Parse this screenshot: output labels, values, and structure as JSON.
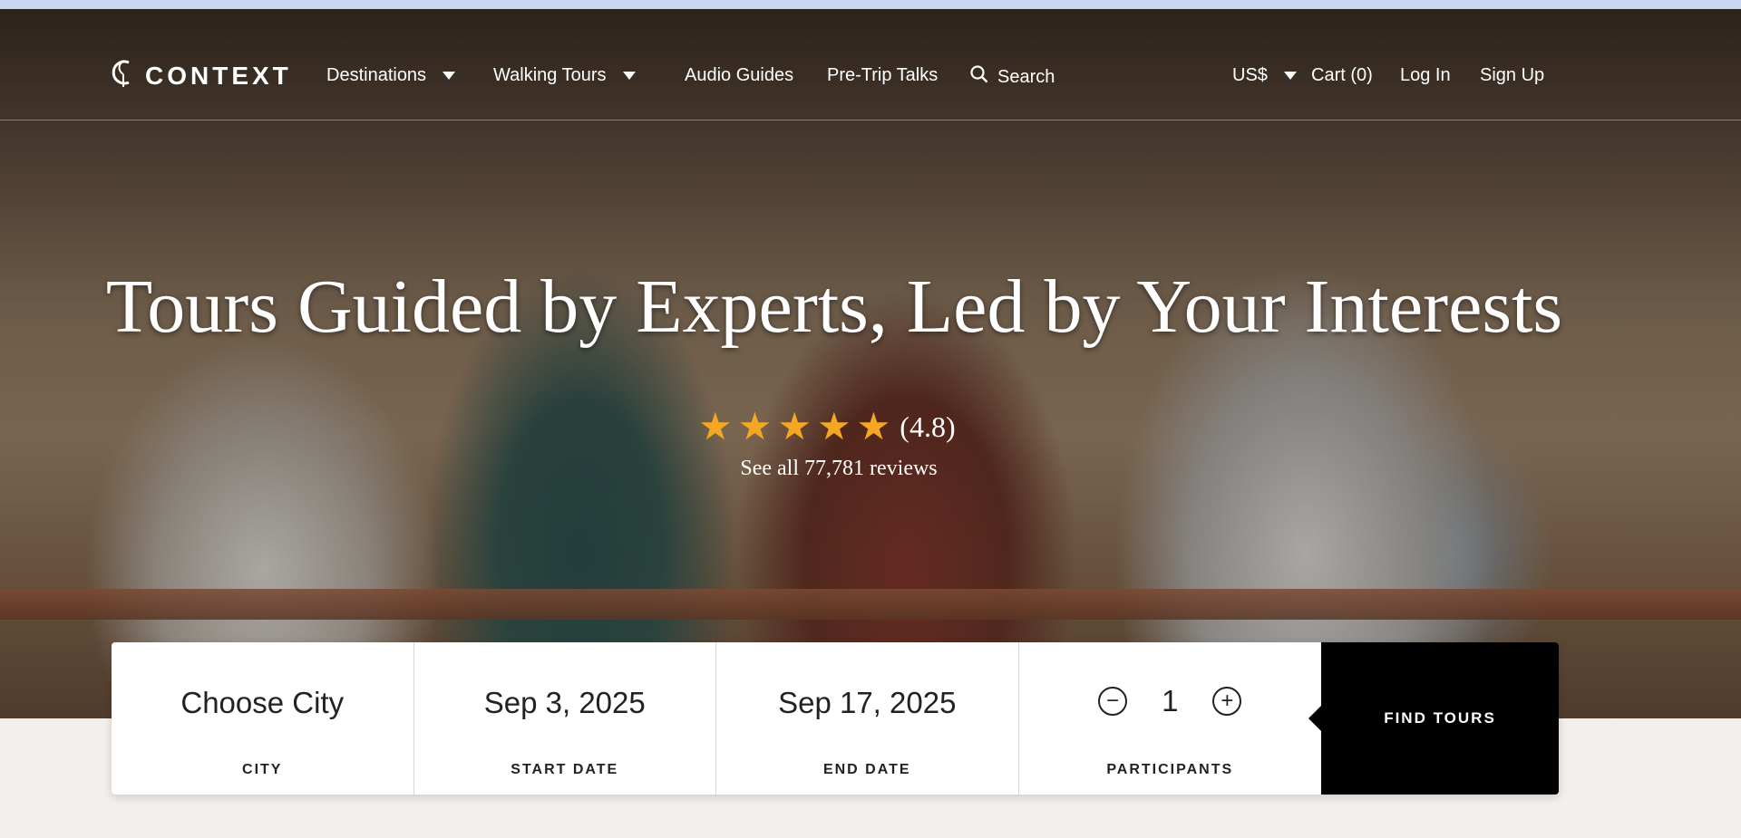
{
  "nav": {
    "logo": "CONTEXT",
    "destinations": "Destinations",
    "walking_tours": "Walking Tours",
    "audio_guides": "Audio Guides",
    "pre_trip_talks": "Pre-Trip Talks",
    "search": "Search",
    "currency": "US$",
    "cart": "Cart (0)",
    "login": "Log In",
    "signup": "Sign Up"
  },
  "hero": {
    "headline": "Tours Guided by Experts, Led by Your Interests",
    "rating_value": "(4.8)",
    "rating_stars": 5,
    "reviews_link": "See all 77,781 reviews"
  },
  "search_panel": {
    "city": {
      "value": "Choose City",
      "label": "CITY"
    },
    "start_date": {
      "value": "Sep 3, 2025",
      "label": "START DATE"
    },
    "end_date": {
      "value": "Sep 17, 2025",
      "label": "END DATE"
    },
    "participants": {
      "value": "1",
      "label": "PARTICIPANTS"
    },
    "find_button": "FIND TOURS"
  },
  "icons": [
    "logo-icon",
    "chevron-down-icon",
    "search-icon",
    "star-icon",
    "minus-icon",
    "plus-icon"
  ],
  "colors": {
    "star": "#f5a623",
    "button": "#000000",
    "panel": "#ffffff",
    "page_bg": "#f2efec"
  }
}
